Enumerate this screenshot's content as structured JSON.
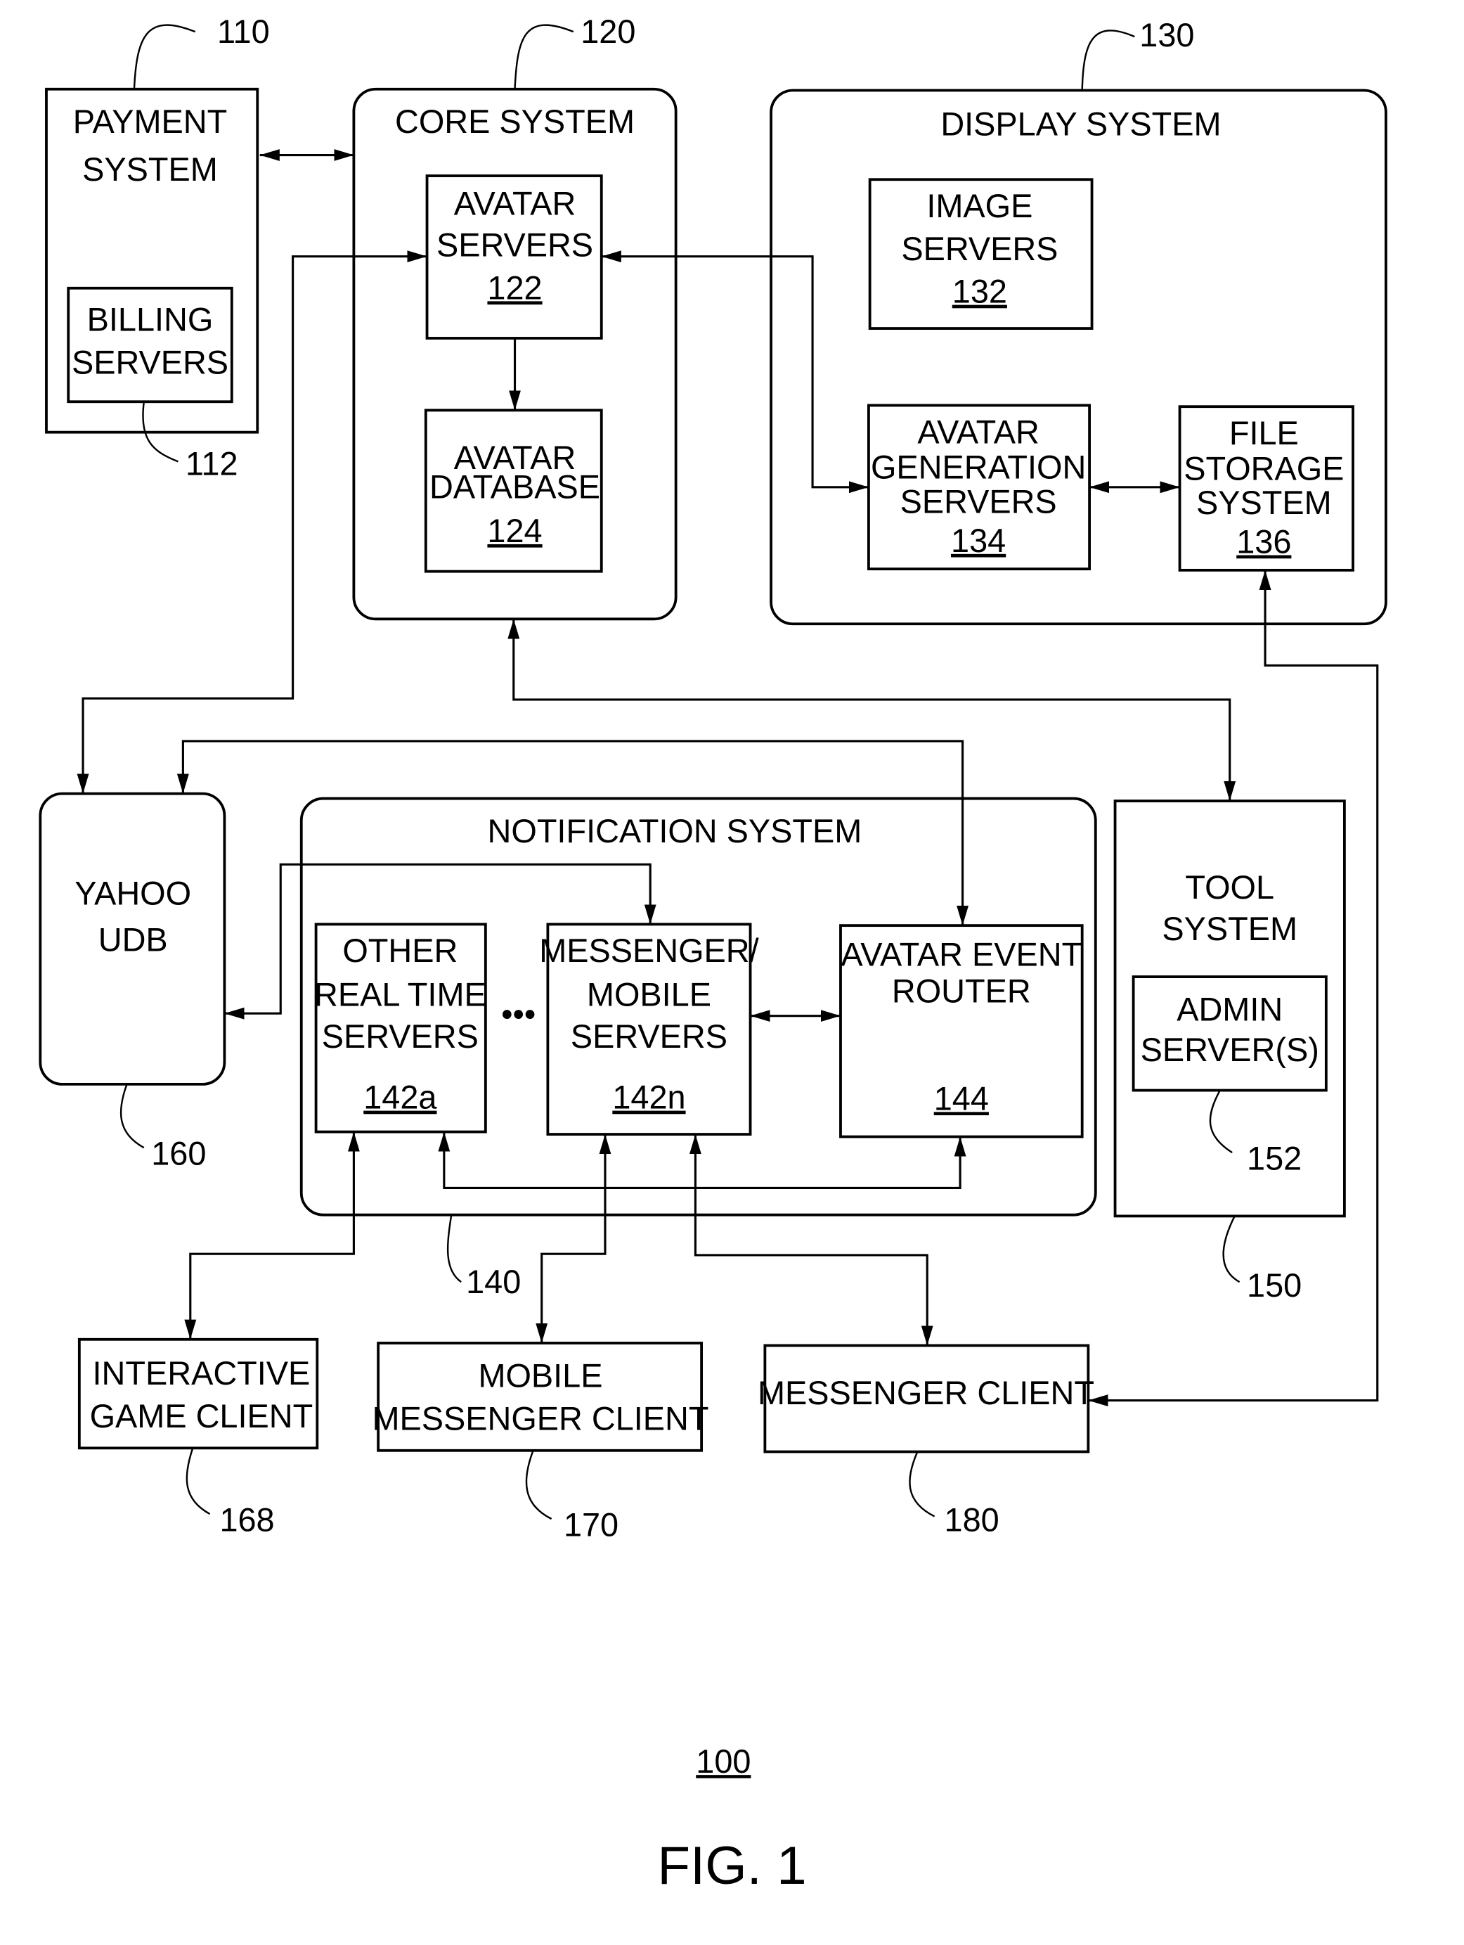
{
  "figure": {
    "caption": "FIG. 1",
    "system_number": "100"
  },
  "blocks": {
    "payment_system": {
      "label_lines": [
        "PAYMENT",
        "SYSTEM"
      ],
      "ref": "110"
    },
    "billing_servers": {
      "label_lines": [
        "BILLING",
        "SERVERS"
      ],
      "ref": "112"
    },
    "core_system": {
      "label": "CORE SYSTEM",
      "ref": "120"
    },
    "avatar_servers": {
      "label_lines": [
        "AVATAR",
        "SERVERS"
      ],
      "number": "122"
    },
    "avatar_database": {
      "label_lines": [
        "AVATAR",
        "DATABASE"
      ],
      "number": "124"
    },
    "display_system": {
      "label": "DISPLAY SYSTEM",
      "ref": "130"
    },
    "image_servers": {
      "label_lines": [
        "IMAGE",
        "SERVERS"
      ],
      "number": "132"
    },
    "avatar_generation_servers": {
      "label_lines": [
        "AVATAR",
        "GENERATION",
        "SERVERS"
      ],
      "number": "134"
    },
    "file_storage_system": {
      "label_lines": [
        "FILE",
        "STORAGE",
        "SYSTEM"
      ],
      "number": "136"
    },
    "yahoo_udb": {
      "label_lines": [
        "YAHOO",
        "UDB"
      ],
      "ref": "160"
    },
    "notification_system": {
      "label": "NOTIFICATION SYSTEM",
      "ref": "140"
    },
    "other_real_time_servers": {
      "label_lines": [
        "OTHER",
        "REAL TIME",
        "SERVERS"
      ],
      "number": "142a"
    },
    "ellipsis": "•••",
    "messenger_mobile_servers": {
      "label_lines": [
        "MESSENGER/",
        "MOBILE",
        "SERVERS"
      ],
      "number": "142n"
    },
    "avatar_event_router": {
      "label_lines": [
        "AVATAR EVENT",
        "ROUTER"
      ],
      "number": "144"
    },
    "tool_system": {
      "label_lines": [
        "TOOL",
        "SYSTEM"
      ],
      "ref": "150"
    },
    "admin_servers": {
      "label_lines": [
        "ADMIN",
        "SERVER(S)"
      ],
      "ref": "152"
    },
    "interactive_game_client": {
      "label_lines": [
        "INTERACTIVE",
        "GAME CLIENT"
      ],
      "ref": "168"
    },
    "mobile_messenger_client": {
      "label_lines": [
        "MOBILE",
        "MESSENGER CLIENT"
      ],
      "ref": "170"
    },
    "messenger_client": {
      "label": "MESSENGER CLIENT",
      "ref": "180"
    }
  }
}
